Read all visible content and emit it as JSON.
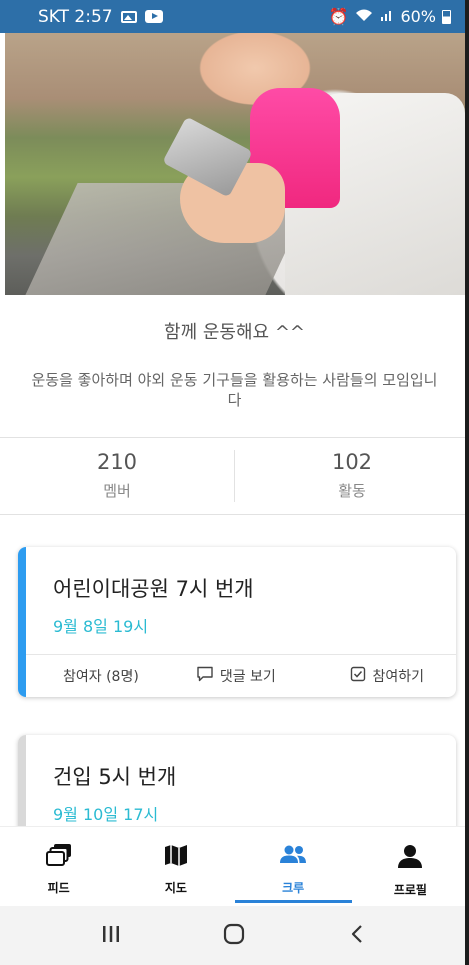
{
  "status_bar": {
    "carrier_time": "SKT 2:57",
    "battery": "60%"
  },
  "crew": {
    "title": "함께 운동해요 ^^",
    "description": "운동을 좋아하며 야외 운동 기구들을 활용하는 사람들의 모임입니다",
    "stats": [
      {
        "value": "210",
        "label": "멤버"
      },
      {
        "value": "102",
        "label": "활동"
      }
    ]
  },
  "events": [
    {
      "title": "어린이대공원 7시 번개",
      "date": "9월 8일 19시",
      "participants": "참여자 (8명)",
      "comments": "댓글 보기",
      "join": "참여하기",
      "accent": "#2d9cf0"
    },
    {
      "title": "건입 5시 번개",
      "date": "9월 10일 17시",
      "accent": "#d9d9d9"
    }
  ],
  "bottom_nav": [
    {
      "label": "피드",
      "icon": "feed-icon"
    },
    {
      "label": "지도",
      "icon": "map-icon"
    },
    {
      "label": "크루",
      "icon": "crew-icon",
      "active": true
    },
    {
      "label": "프로필",
      "icon": "profile-icon"
    }
  ],
  "colors": {
    "accent": "#2a82d8",
    "date": "#2bbbd2",
    "status_bar": "#2d6fa8"
  }
}
